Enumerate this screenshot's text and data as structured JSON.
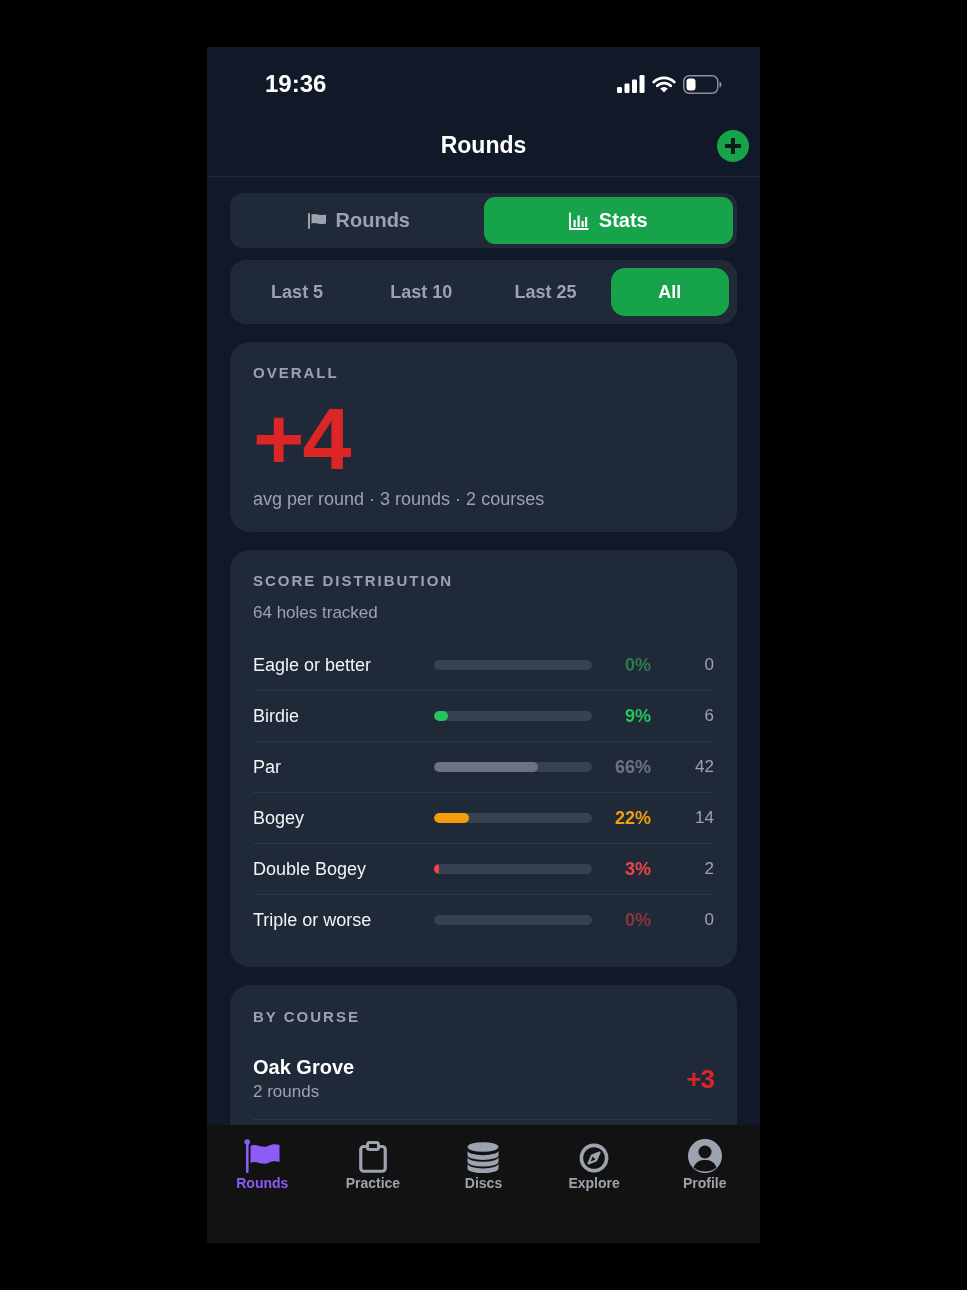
{
  "status_bar": {
    "time": "19:36"
  },
  "header": {
    "title": "Rounds"
  },
  "view_tabs": [
    {
      "label": "Rounds",
      "selected": false
    },
    {
      "label": "Stats",
      "selected": true
    }
  ],
  "range_filter": [
    {
      "label": "Last 5",
      "selected": false
    },
    {
      "label": "Last 10",
      "selected": false
    },
    {
      "label": "Last 25",
      "selected": false
    },
    {
      "label": "All",
      "selected": true
    }
  ],
  "overall": {
    "heading": "OVERALL",
    "value": "+4",
    "summary": "avg per round · 3 rounds · 2 courses"
  },
  "score_distribution": {
    "heading": "SCORE DISTRIBUTION",
    "subtitle": "64 holes tracked",
    "rows": [
      {
        "label": "Eagle or better",
        "percent": "0%",
        "count": "0",
        "color": "#2f7a4f"
      },
      {
        "label": "Birdie",
        "level": 0.09,
        "percent": "9%",
        "count": "6",
        "color": "#22c55e"
      },
      {
        "label": "Par",
        "level": 0.66,
        "percent": "66%",
        "count": "42",
        "color": "#6b7280"
      },
      {
        "label": "Bogey",
        "level": 0.22,
        "percent": "22%",
        "count": "14",
        "color": "#f59e0b"
      },
      {
        "label": "Double Bogey",
        "level": 0.03,
        "percent": "3%",
        "count": "2",
        "color": "#ef4444"
      },
      {
        "label": "Triple or worse",
        "percent": "0%",
        "count": "0",
        "color": "#8c3440"
      }
    ]
  },
  "by_course": {
    "heading": "BY COURSE",
    "courses": [
      {
        "name": "Oak Grove",
        "rounds": "2 rounds",
        "score": "+3"
      }
    ]
  },
  "tab_bar": {
    "items": [
      {
        "label": "Rounds",
        "selected": true
      },
      {
        "label": "Practice",
        "selected": false
      },
      {
        "label": "Discs",
        "selected": false
      },
      {
        "label": "Explore",
        "selected": false
      },
      {
        "label": "Profile",
        "selected": false
      }
    ]
  }
}
